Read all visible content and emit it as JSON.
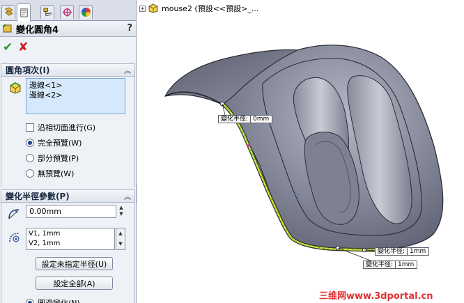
{
  "property_manager": {
    "tabs": [
      "feature-manager-icon",
      "property-manager-icon",
      "configuration-manager-icon",
      "dimxpert-icon",
      "display-manager-icon"
    ],
    "title": "變化圓角4",
    "help": "?",
    "ok_icon": "✔",
    "cancel_icon": "✘",
    "fillet_items": {
      "header": "圓角項次(I)",
      "edges": [
        "邊線<1>",
        "邊線<2>"
      ],
      "tangent_propagation": {
        "label": "沿相切面進行(G)",
        "checked": false
      },
      "preview_options": [
        {
          "label": "完全預覽(W)",
          "selected": true
        },
        {
          "label": "部分預覽(P)",
          "selected": false
        },
        {
          "label": "無預覽(W)",
          "selected": false
        }
      ]
    },
    "variable_radius": {
      "header": "變化半徑參數(P)",
      "radius_value": "0.00mm",
      "vertices": [
        "V1, 1mm",
        "V2, 1mm"
      ],
      "set_unassigned_button": "設定未指定半徑(U)",
      "set_all_button": "設定全部(A)",
      "smooth_transition": {
        "label": "圓滑變化(N)",
        "selected": true
      }
    }
  },
  "graphics": {
    "tree_label": "mouse2 (預設<<預設>_...",
    "callouts": [
      {
        "label": "變化半徑:",
        "value": "0mm"
      },
      {
        "label": "變化半徑:",
        "value": "1mm"
      },
      {
        "label": "變化半徑:",
        "value": "1mm"
      }
    ],
    "watermark": "三维网www.3dportal.cn"
  }
}
